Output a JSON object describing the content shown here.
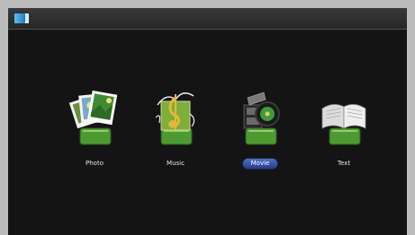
{
  "topbar": {
    "source_icon": "input-source-icon"
  },
  "menu": {
    "items": [
      {
        "label": "Photo",
        "icon": "photo-icon",
        "selected": false
      },
      {
        "label": "Music",
        "icon": "music-icon",
        "selected": false
      },
      {
        "label": "Movie",
        "icon": "movie-icon",
        "selected": true
      },
      {
        "label": "Text",
        "icon": "text-icon",
        "selected": false
      }
    ]
  },
  "colors": {
    "background": "#141414",
    "frame": "#bcbcbc",
    "base_green": "#5aa83a",
    "selected_label": "#2a45a0"
  }
}
